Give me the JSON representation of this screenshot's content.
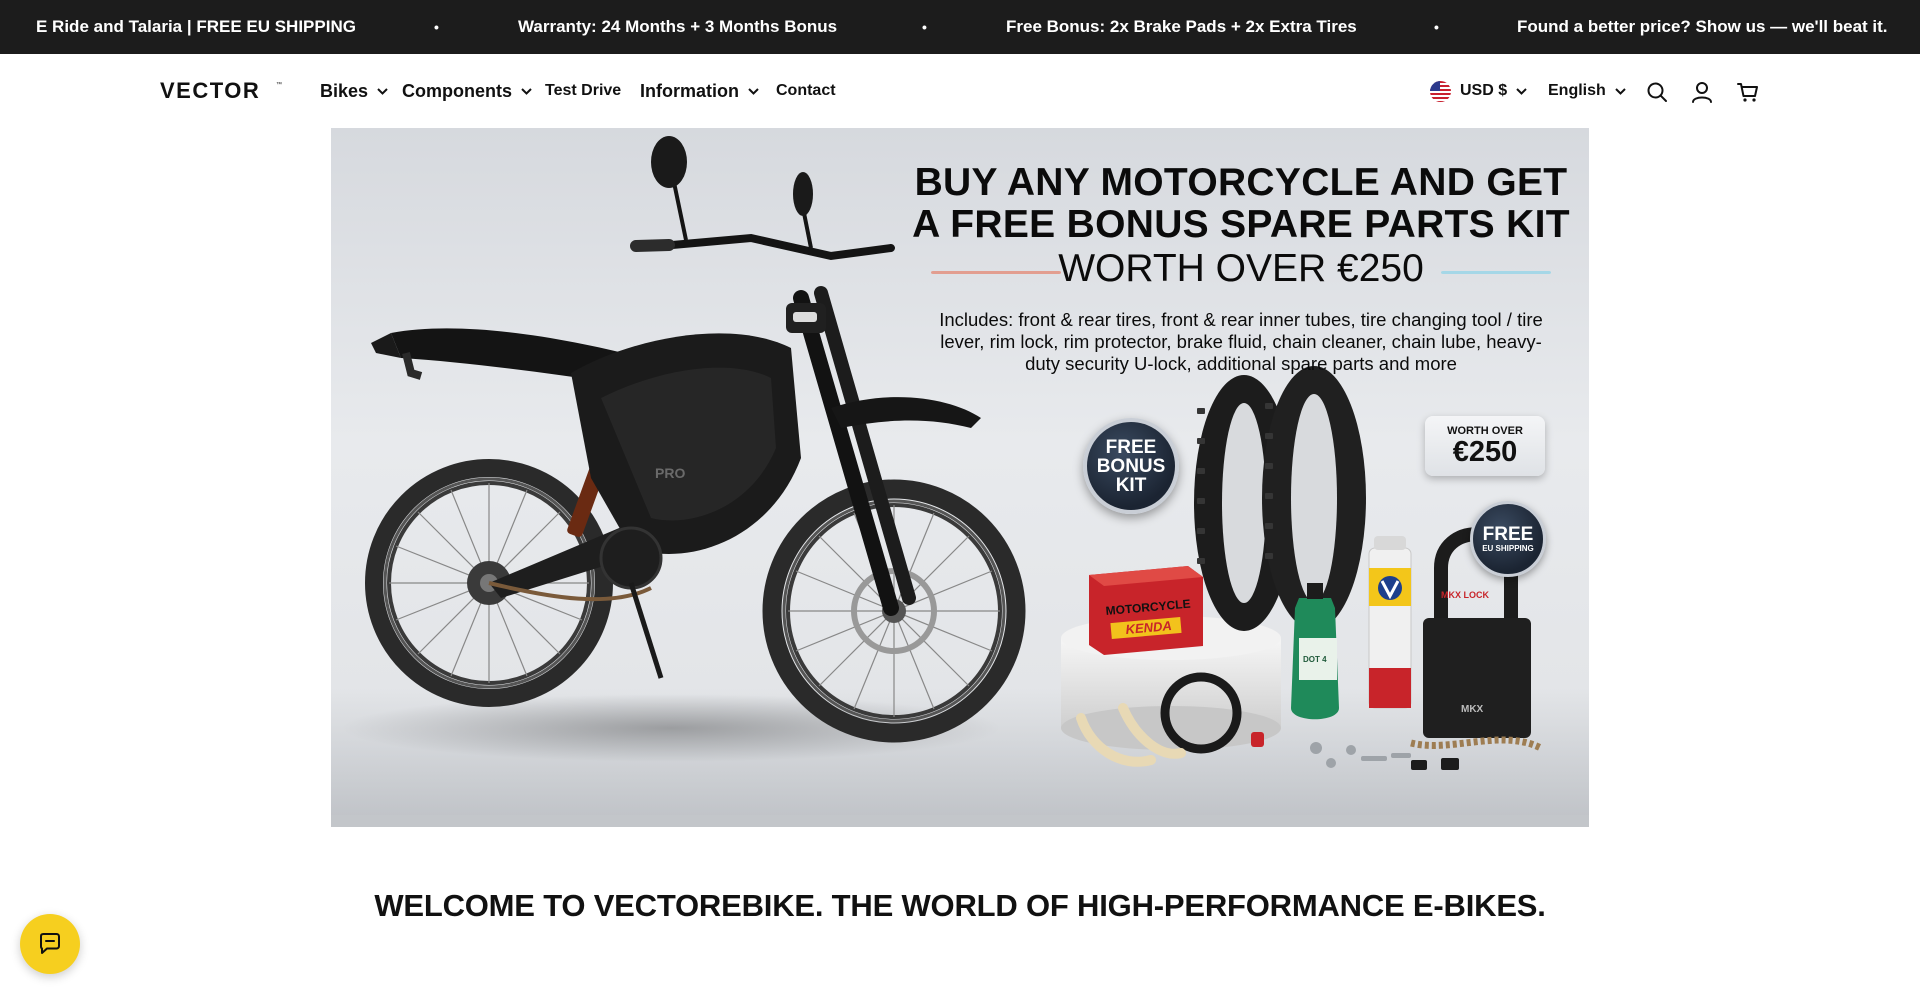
{
  "announcement": {
    "messages": [
      "E Ride and Talaria | FREE EU SHIPPING",
      "Warranty: 24 Months + 3 Months Bonus",
      "Free Bonus: 2x Brake Pads + 2x Extra Tires",
      "Found a better price? Show us — we'll beat it."
    ],
    "separator": "•"
  },
  "header": {
    "logo_text": "VECTOR",
    "nav": [
      {
        "label": "Bikes",
        "has_dropdown": true
      },
      {
        "label": "Components",
        "has_dropdown": true
      },
      {
        "label": "Test Drive",
        "has_dropdown": false
      },
      {
        "label": "Information",
        "has_dropdown": true
      },
      {
        "label": "Contact",
        "has_dropdown": false
      }
    ],
    "currency": "USD $",
    "language": "English",
    "icons": [
      "search-icon",
      "account-icon",
      "cart-icon"
    ]
  },
  "hero": {
    "line1": "BUY ANY MOTORCYCLE AND GET",
    "line2": "A FREE BONUS SPARE PARTS KIT",
    "line3": "WORTH OVER €250",
    "includes": "Includes: front & rear tires, front & rear inner tubes, tire changing tool / tire lever, rim lock, rim protector, brake fluid, chain cleaner, chain lube, heavy-duty security U-lock, additional spare parts and more",
    "badge_bonus": [
      "FREE",
      "BONUS",
      "KIT"
    ],
    "badge_worth_top": "WORTH OVER",
    "badge_worth_value": "€250",
    "badge_ship_top": "FREE",
    "badge_ship_bottom": "EU SHIPPING",
    "box_brand": "KENDA",
    "box_label": "MOTORCYCLE",
    "bottle_label": "DOT 4",
    "lock_brand": "MKX"
  },
  "welcome": {
    "heading": "WELCOME TO VECTOREBIKE. THE WORLD OF HIGH-PERFORMANCE E-BIKES."
  },
  "colors": {
    "announcement_bg": "#1c1c1c",
    "chat_accent": "#f6cf1f"
  }
}
